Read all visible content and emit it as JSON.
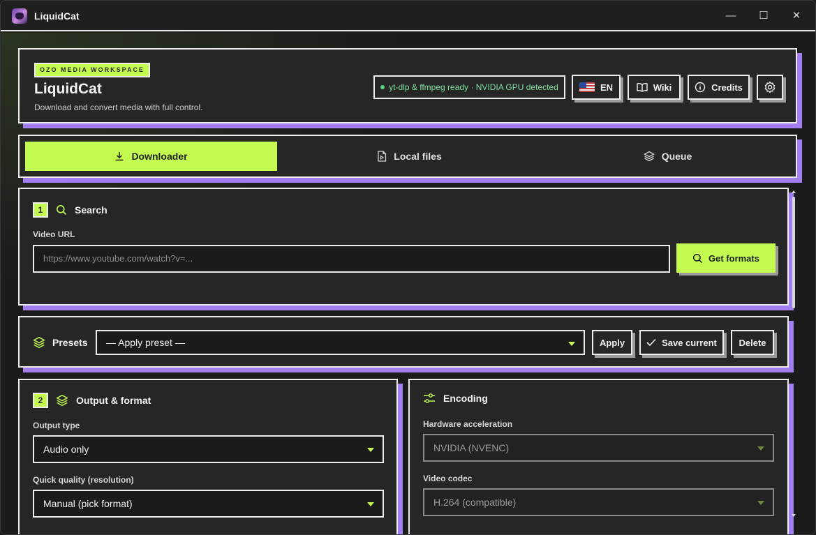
{
  "window": {
    "title": "LiquidCat",
    "minimize": "—",
    "maximize": "☐",
    "close": "✕"
  },
  "header": {
    "badge": "OZO MEDIA WORKSPACE",
    "title": "LiquidCat",
    "subtitle": "Download and convert media with full control.",
    "status": "yt-dlp & ffmpeg ready · NVIDIA GPU detected",
    "lang_label": "EN",
    "wiki_label": "Wiki",
    "credits_label": "Credits"
  },
  "tabs": [
    {
      "label": "Downloader",
      "active": true
    },
    {
      "label": "Local files",
      "active": false
    },
    {
      "label": "Queue",
      "active": false
    }
  ],
  "search": {
    "step": "1",
    "title": "Search",
    "url_label": "Video URL",
    "url_placeholder": "https://www.youtube.com/watch?v=...",
    "get_formats_label": "Get formats"
  },
  "presets": {
    "title": "Presets",
    "select_value": "— Apply preset —",
    "apply_label": "Apply",
    "save_label": "Save current",
    "delete_label": "Delete"
  },
  "output": {
    "step": "2",
    "title": "Output & format",
    "type_label": "Output type",
    "type_value": "Audio only",
    "quality_label": "Quick quality (resolution)",
    "quality_value": "Manual (pick format)"
  },
  "encoding": {
    "title": "Encoding",
    "hw_label": "Hardware acceleration",
    "hw_value": "NVIDIA (NVENC)",
    "codec_label": "Video codec",
    "codec_value": "H.264 (compatible)"
  },
  "colors": {
    "accent": "#c4fb50",
    "shadow": "#a27ef2",
    "border": "#ededed",
    "status": "#7ee0a3"
  }
}
